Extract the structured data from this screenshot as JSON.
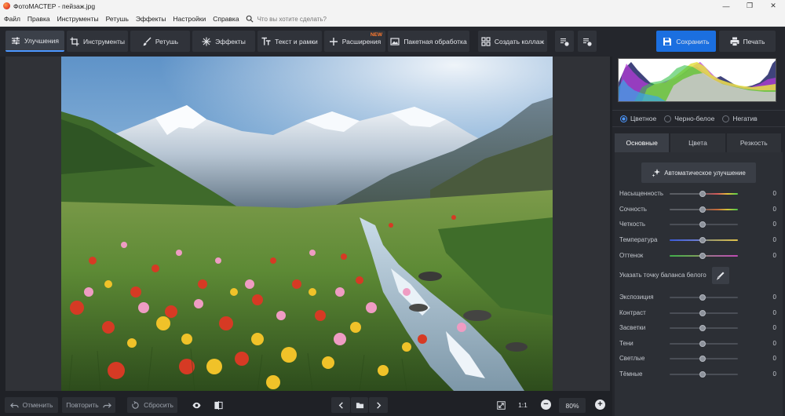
{
  "window": {
    "title": "ФотоМАСТЕР - пейзаж.jpg",
    "minimize_glyph": "—",
    "restore_glyph": "❐",
    "close_glyph": "✕"
  },
  "menu": {
    "items": [
      "Файл",
      "Правка",
      "Инструменты",
      "Ретушь",
      "Эффекты",
      "Настройки",
      "Справка"
    ],
    "search_placeholder": "Что вы хотите сделать?"
  },
  "toolbar": {
    "enhance": "Улучшения",
    "tools": "Инструменты",
    "retouch": "Ретушь",
    "effects": "Эффекты",
    "text": "Текст и рамки",
    "extensions": "Расширения",
    "extensions_badge": "NEW",
    "batch": "Пакетная обработка",
    "collage": "Создать коллаж",
    "save": "Сохранить",
    "print": "Печать",
    "accent": "#1b6fe0"
  },
  "bottom": {
    "undo": "Отменить",
    "redo": "Повторить",
    "reset": "Сбросить",
    "ratio": "1:1",
    "zoom": "80%",
    "zoom_out": "−",
    "zoom_in": "+"
  },
  "panel": {
    "modes": [
      {
        "label": "Цветное",
        "selected": true
      },
      {
        "label": "Черно-белое",
        "selected": false
      },
      {
        "label": "Негатив",
        "selected": false
      }
    ],
    "tabs": [
      "Основные",
      "Цвета",
      "Резкость"
    ],
    "active_tab": "Основные",
    "auto_button": "Автоматическое улучшение",
    "sliders_top": [
      {
        "label": "Насыщенность",
        "value": "0"
      },
      {
        "label": "Сочность",
        "value": "0"
      },
      {
        "label": "Четкость",
        "value": "0"
      },
      {
        "label": "Температура",
        "value": "0"
      },
      {
        "label": "Оттенок",
        "value": "0"
      }
    ],
    "white_balance_label": "Указать точку баланса белого",
    "sliders_bottom": [
      {
        "label": "Экспозиция",
        "value": "0"
      },
      {
        "label": "Контраст",
        "value": "0"
      },
      {
        "label": "Засветки",
        "value": "0"
      },
      {
        "label": "Тени",
        "value": "0"
      },
      {
        "label": "Светлые",
        "value": "0"
      },
      {
        "label": "Тёмные",
        "value": "0"
      }
    ]
  }
}
